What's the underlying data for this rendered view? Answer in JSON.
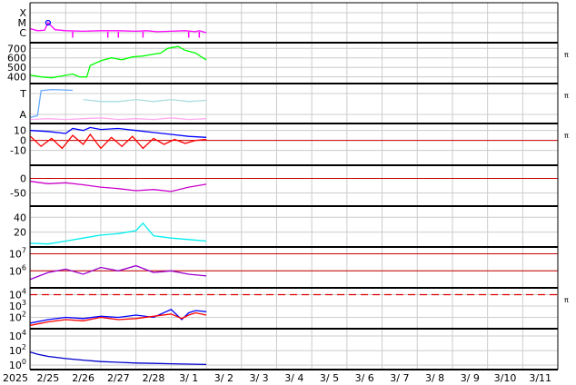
{
  "chart_data": {
    "type": "line",
    "title": "",
    "date_axis": {
      "start_label": "2025",
      "ticks": [
        "2/25",
        "2/26",
        "2/27",
        "2/28",
        "3/ 1",
        "3/ 2",
        "3/ 3",
        "3/ 4",
        "3/ 5",
        "3/ 6",
        "3/ 7",
        "3/ 8",
        "3/ 9",
        "3/10",
        "3/11"
      ],
      "data_end_day": 5.0
    },
    "panels": [
      {
        "id": "xray",
        "ytick_labels": [
          "X",
          "M",
          "C"
        ],
        "yrange_levels": [
          "C",
          "X"
        ],
        "series": [
          {
            "color": "#ff00ff",
            "points": [
              [
                0,
                1.4
              ],
              [
                0.2,
                1.2
              ],
              [
                0.4,
                1.25
              ],
              [
                0.5,
                2.0
              ],
              [
                0.7,
                1.3
              ],
              [
                1.0,
                1.2
              ],
              [
                1.5,
                1.15
              ],
              [
                2.0,
                1.2
              ],
              [
                2.5,
                1.2
              ],
              [
                3.0,
                1.15
              ],
              [
                3.3,
                1.2
              ],
              [
                3.6,
                1.1
              ],
              [
                4.0,
                1.15
              ],
              [
                4.4,
                1.2
              ],
              [
                4.7,
                1.1
              ],
              [
                4.8,
                1.2
              ],
              [
                5.0,
                1.0
              ]
            ]
          }
        ],
        "markers": [
          {
            "x": 0.5,
            "level": 2.0,
            "color": "#0000ff"
          }
        ],
        "dips": [
          1.2,
          2.2,
          2.5,
          3.2,
          4.5,
          4.8
        ]
      },
      {
        "id": "solar-wind-speed",
        "ytick_labels": [
          "700",
          "600",
          "500",
          "400"
        ],
        "ytick_values": [
          700,
          600,
          500,
          400
        ],
        "ylim": [
          330,
          760
        ],
        "series": [
          {
            "color": "#00ff00",
            "points": [
              [
                0,
                420
              ],
              [
                0.3,
                400
              ],
              [
                0.6,
                390
              ],
              [
                0.9,
                410
              ],
              [
                1.2,
                430
              ],
              [
                1.4,
                400
              ],
              [
                1.6,
                400
              ],
              [
                1.7,
                520
              ],
              [
                2.0,
                570
              ],
              [
                2.3,
                600
              ],
              [
                2.6,
                580
              ],
              [
                2.9,
                610
              ],
              [
                3.2,
                620
              ],
              [
                3.5,
                640
              ],
              [
                3.7,
                650
              ],
              [
                3.9,
                700
              ],
              [
                4.2,
                720
              ],
              [
                4.4,
                680
              ],
              [
                4.7,
                650
              ],
              [
                4.9,
                600
              ],
              [
                5.0,
                580
              ]
            ]
          }
        ]
      },
      {
        "id": "temperature-alpha",
        "ytick_labels": [
          "T",
          "A"
        ],
        "series": [
          {
            "color": "#66aaff",
            "points": [
              [
                0,
                0.15
              ],
              [
                0.2,
                0.2
              ],
              [
                0.3,
                0.82
              ],
              [
                0.6,
                0.85
              ],
              [
                0.9,
                0.84
              ],
              [
                1.2,
                0.83
              ]
            ]
          },
          {
            "color": "#aadddd",
            "points": [
              [
                1.5,
                0.6
              ],
              [
                2.0,
                0.55
              ],
              [
                2.5,
                0.55
              ],
              [
                3.0,
                0.6
              ],
              [
                3.5,
                0.55
              ],
              [
                4.0,
                0.6
              ],
              [
                4.5,
                0.55
              ],
              [
                5.0,
                0.58
              ]
            ]
          },
          {
            "color": "#ffaaee",
            "points": [
              [
                0,
                0.1
              ],
              [
                0.5,
                0.12
              ],
              [
                1.0,
                0.1
              ],
              [
                1.5,
                0.12
              ],
              [
                2.0,
                0.14
              ],
              [
                2.5,
                0.1
              ],
              [
                3.0,
                0.12
              ],
              [
                3.5,
                0.1
              ],
              [
                4.0,
                0.14
              ],
              [
                4.5,
                0.1
              ],
              [
                5.0,
                0.12
              ]
            ]
          }
        ]
      },
      {
        "id": "imf-bt-bz",
        "ytick_labels": [
          "10",
          "0",
          "-10"
        ],
        "ytick_values": [
          10,
          0,
          -10
        ],
        "ylim": [
          -25,
          17
        ],
        "zero_line": 0,
        "series": [
          {
            "color": "#0000ff",
            "points": [
              [
                0,
                10
              ],
              [
                0.5,
                9
              ],
              [
                1.0,
                7
              ],
              [
                1.2,
                12
              ],
              [
                1.5,
                10
              ],
              [
                1.7,
                13
              ],
              [
                2.0,
                11
              ],
              [
                2.5,
                12
              ],
              [
                3.0,
                10
              ],
              [
                3.5,
                8
              ],
              [
                4.0,
                6
              ],
              [
                4.5,
                4
              ],
              [
                5.0,
                3
              ]
            ]
          },
          {
            "color": "#ff0000",
            "points": [
              [
                0,
                4
              ],
              [
                0.3,
                -6
              ],
              [
                0.6,
                2
              ],
              [
                0.9,
                -8
              ],
              [
                1.2,
                5
              ],
              [
                1.5,
                -4
              ],
              [
                1.7,
                6
              ],
              [
                2.0,
                -8
              ],
              [
                2.3,
                3
              ],
              [
                2.6,
                -6
              ],
              [
                2.9,
                4
              ],
              [
                3.2,
                -8
              ],
              [
                3.5,
                2
              ],
              [
                3.8,
                -4
              ],
              [
                4.1,
                1
              ],
              [
                4.4,
                -3
              ],
              [
                4.7,
                0
              ],
              [
                5.0,
                1
              ]
            ]
          }
        ]
      },
      {
        "id": "dst",
        "ytick_labels": [
          "0",
          "-50"
        ],
        "ytick_values": [
          0,
          -50
        ],
        "ylim": [
          -95,
          45
        ],
        "zero_line": 0,
        "series": [
          {
            "color": "#cc00cc",
            "points": [
              [
                0,
                -10
              ],
              [
                0.5,
                -18
              ],
              [
                1.0,
                -15
              ],
              [
                1.5,
                -22
              ],
              [
                2.0,
                -30
              ],
              [
                2.5,
                -35
              ],
              [
                3.0,
                -42
              ],
              [
                3.5,
                -38
              ],
              [
                4.0,
                -45
              ],
              [
                4.5,
                -30
              ],
              [
                5.0,
                -20
              ]
            ]
          }
        ]
      },
      {
        "id": "kp-like",
        "ytick_labels": [
          "40",
          "20"
        ],
        "ytick_values": [
          40,
          20
        ],
        "ylim": [
          0,
          55
        ],
        "series": [
          {
            "color": "#00eeee",
            "points": [
              [
                0,
                5
              ],
              [
                0.5,
                4
              ],
              [
                1.0,
                8
              ],
              [
                1.5,
                12
              ],
              [
                2.0,
                16
              ],
              [
                2.5,
                18
              ],
              [
                3.0,
                22
              ],
              [
                3.2,
                32
              ],
              [
                3.5,
                15
              ],
              [
                4.0,
                12
              ],
              [
                4.5,
                10
              ],
              [
                5.0,
                8
              ]
            ]
          }
        ]
      },
      {
        "id": "electron-flux",
        "ytick_labels": [
          "10^7",
          "10^6"
        ],
        "ytick_exponents": [
          7,
          6
        ],
        "ylim_exp": [
          5.0,
          7.4
        ],
        "ref_lines_exp": [
          7.0,
          6.0
        ],
        "series": [
          {
            "color": "#9900cc",
            "points": [
              [
                0,
                5.5
              ],
              [
                0.5,
                5.9
              ],
              [
                1.0,
                6.1
              ],
              [
                1.5,
                5.8
              ],
              [
                2.0,
                6.2
              ],
              [
                2.5,
                6.0
              ],
              [
                3.0,
                6.3
              ],
              [
                3.5,
                5.9
              ],
              [
                4.0,
                6.0
              ],
              [
                4.5,
                5.8
              ],
              [
                5.0,
                5.7
              ]
            ]
          }
        ]
      },
      {
        "id": "proton-flux",
        "ytick_labels": [
          "10^4",
          "10^3",
          "10^2"
        ],
        "ytick_exponents": [
          4,
          3,
          2
        ],
        "ylim_exp": [
          1.0,
          4.6
        ],
        "threshold_exp": 4.0,
        "series": [
          {
            "color": "#0000ff",
            "points": [
              [
                0,
                1.5
              ],
              [
                0.5,
                1.8
              ],
              [
                1.0,
                2.0
              ],
              [
                1.5,
                1.9
              ],
              [
                2.0,
                2.1
              ],
              [
                2.5,
                2.0
              ],
              [
                3.0,
                2.2
              ],
              [
                3.5,
                2.0
              ],
              [
                4.0,
                2.7
              ],
              [
                4.3,
                1.8
              ],
              [
                4.5,
                2.4
              ],
              [
                4.7,
                2.6
              ],
              [
                5.0,
                2.5
              ]
            ]
          },
          {
            "color": "#ff0000",
            "points": [
              [
                0,
                1.3
              ],
              [
                0.5,
                1.6
              ],
              [
                1.0,
                1.8
              ],
              [
                1.5,
                1.7
              ],
              [
                2.0,
                2.0
              ],
              [
                2.5,
                1.8
              ],
              [
                3.0,
                1.9
              ],
              [
                3.5,
                2.1
              ],
              [
                4.0,
                2.3
              ],
              [
                4.3,
                1.9
              ],
              [
                4.5,
                2.2
              ],
              [
                4.7,
                2.4
              ],
              [
                5.0,
                2.2
              ]
            ]
          }
        ]
      },
      {
        "id": "high-energy",
        "ytick_labels": [
          "10^4",
          "10^2",
          "10^0"
        ],
        "ytick_exponents": [
          4,
          2,
          0
        ],
        "ylim_exp": [
          -0.6,
          5.0
        ],
        "series": [
          {
            "color": "#0000cc",
            "points": [
              [
                0,
                1.8
              ],
              [
                0.2,
                1.5
              ],
              [
                0.5,
                1.2
              ],
              [
                1.0,
                0.9
              ],
              [
                1.5,
                0.7
              ],
              [
                2.0,
                0.5
              ],
              [
                2.5,
                0.4
              ],
              [
                3.0,
                0.3
              ],
              [
                3.5,
                0.25
              ],
              [
                4.0,
                0.2
              ],
              [
                4.5,
                0.15
              ],
              [
                5.0,
                0.1
              ]
            ]
          }
        ]
      }
    ],
    "right_marker_glyph": "π",
    "right_marker_panels": [
      "solar-wind-speed",
      "temperature-alpha",
      "imf-bt-bz",
      "proton-flux"
    ],
    "grid": true
  }
}
